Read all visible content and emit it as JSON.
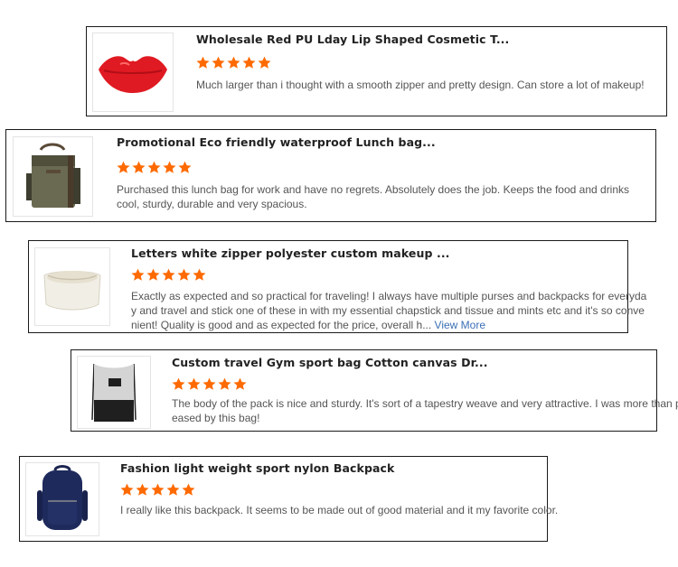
{
  "star_color": "#ff6a00",
  "reviews": [
    {
      "product_title": "Wholesale Red PU Lday Lip Shaped Cosmetic T...",
      "rating": 5,
      "review_lines": [
        "Much larger than i thought with a smooth zipper and pretty design. Can store a lot of makeup!"
      ],
      "image_icon": "red-lips-bag-icon"
    },
    {
      "product_title": "Promotional Eco friendly waterproof Lunch bag...",
      "rating": 5,
      "review_lines": [
        "Purchased this lunch bag for work and have no regrets. Absolutely does the job. Keeps the food and drinks",
        "cool, sturdy, durable and very spacious."
      ],
      "image_icon": "canvas-lunch-bag-icon"
    },
    {
      "product_title": "Letters white zipper polyester custom makeup ...",
      "rating": 5,
      "review_lines": [
        "Exactly as expected and so practical for traveling! I always have multiple purses and backpacks for everyda",
        "y and travel and stick one of these in with my essential chapstick and tissue and mints etc and it's so conve",
        "nient! Quality is good and as expected for the price, overall h..."
      ],
      "view_more": "View More",
      "image_icon": "white-pouch-icon"
    },
    {
      "product_title": "Custom travel Gym sport bag Cotton canvas Dr...",
      "rating": 5,
      "review_lines": [
        "The body of the pack is nice and sturdy. It's sort of a tapestry weave and very attractive. I was more than pl",
        "eased by this bag!"
      ],
      "image_icon": "drawstring-bag-icon"
    },
    {
      "product_title": "Fashion light weight sport nylon Backpack",
      "rating": 5,
      "review_lines": [
        "I really like this backpack. It seems to be made out of good material and it my favorite color."
      ],
      "image_icon": "navy-backpack-icon"
    }
  ]
}
